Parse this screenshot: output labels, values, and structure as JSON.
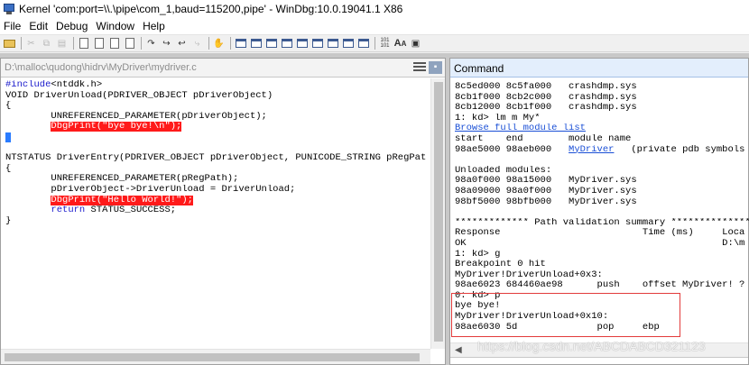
{
  "window": {
    "title": "Kernel 'com:port=\\\\.\\pipe\\com_1,baud=115200,pipe' - WinDbg:10.0.19041.1 X86"
  },
  "menu": {
    "items": [
      "File",
      "Edit",
      "Debug",
      "Window",
      "Help"
    ]
  },
  "toolbar": {
    "icons": [
      "open-folder-icon",
      "cut-icon",
      "copy-icon",
      "paste-icon",
      "go-icon",
      "restart-icon",
      "stop-icon",
      "break-icon",
      "step-into-icon",
      "step-over-icon",
      "step-out-icon",
      "run-to-cursor-icon",
      "toggle-breakpoint-icon",
      "command-window-icon",
      "watch-window-icon",
      "locals-window-icon",
      "registers-window-icon",
      "memory-window-icon",
      "call-stack-window-icon",
      "disassembly-window-icon",
      "scratch-pad-icon",
      "processes-threads-icon",
      "source-mode-icon",
      "font-icon",
      "options-icon"
    ],
    "source_mode_label": "101\n101",
    "font_label": "AA"
  },
  "source": {
    "path": "D:\\malloc\\qudong\\hidrv\\MyDriver\\mydriver.c",
    "lines": [
      "#include<ntddk.h>",
      "VOID DriverUnload(PDRIVER_OBJECT pDriverObject)",
      "{",
      "        UNREFERENCED_PARAMETER(pDriverObject);",
      "        DbgPrint(\"bye bye!\\n\");",
      "}",
      "",
      "NTSTATUS DriverEntry(PDRIVER_OBJECT pDriverObject, PUNICODE_STRING pRegPat",
      "{",
      "        UNREFERENCED_PARAMETER(pRegPath);",
      "        pDriverObject->DriverUnload = DriverUnload;",
      "        DbgPrint(\"Hello World!\");",
      "        return STATUS_SUCCESS;",
      "}"
    ],
    "breakpoint_lines": [
      4,
      11
    ],
    "current_line": 5
  },
  "command": {
    "title": "Command",
    "output": [
      "8c5ed000 8c5fa000   crashdmp.sys",
      "8cb1f000 8cb2c000   crashdmp.sys",
      "8cb12000 8cb1f000   crashdmp.sys",
      "1: kd> lm m My*",
      "Browse full module list",
      "start    end        module name",
      "98ae5000 98aeb000   MyDriver   (private pdb symbols",
      "",
      "Unloaded modules:",
      "98a0f000 98a15000   MyDriver.sys",
      "98a09000 98a0f000   MyDriver.sys",
      "98bf5000 98bfb000   MyDriver.sys",
      "",
      "************* Path validation summary ***************",
      "Response                         Time (ms)     Loca",
      "OK                                             D:\\m",
      "1: kd> g",
      "Breakpoint 0 hit",
      "MyDriver!DriverUnload+0x3:",
      "98ae6023 684460ae98      push    offset MyDriver! ?",
      "0: kd> p",
      "bye bye!",
      "MyDriver!DriverUnload+0x10:",
      "98ae6030 5d              pop     ebp"
    ],
    "link_text": "Browse full module list",
    "module_link": "MyDriver"
  },
  "watermark": "https://blog.csdn.net/ABCDABCD321123"
}
